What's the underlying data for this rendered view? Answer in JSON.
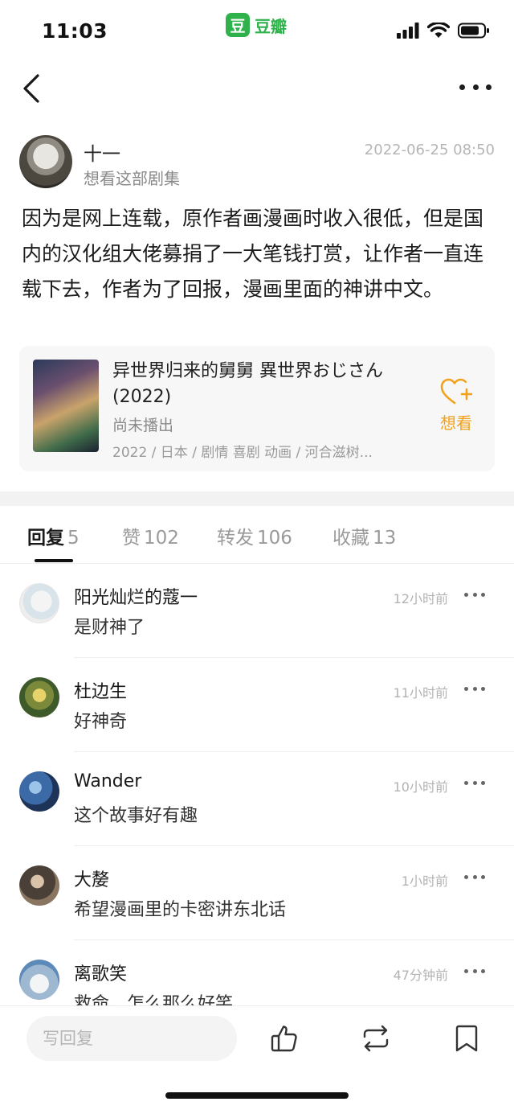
{
  "status_bar": {
    "time": "11:03",
    "app_logo_char": "豆",
    "app_name": "豆瓣"
  },
  "post": {
    "author_name": "十一",
    "author_subtitle": "想看这部剧集",
    "timestamp": "2022-06-25 08:50",
    "content": "因为是网上连载，原作者画漫画时收入很低，但是国内的汉化组大佬募捐了一大笔钱打赏，让作者一直连载下去，作者为了回报，漫画里面的神讲中文。"
  },
  "subject_card": {
    "title": "异世界归来的舅舅 異世界おじさん (2022)",
    "status": "尚未播出",
    "meta": "2022 / 日本 / 剧情 喜剧 动画 / 河合滋树...",
    "wish_label": "想看",
    "wish_icon": "heart-plus-icon"
  },
  "tabs": [
    {
      "label": "回复",
      "count": "5",
      "active": true
    },
    {
      "label": "赞",
      "count": "102"
    },
    {
      "label": "转发",
      "count": "106"
    },
    {
      "label": "收藏",
      "count": "13"
    }
  ],
  "replies": [
    {
      "name": "阳光灿烂的蔻一",
      "text": "是财神了",
      "time": "12小时前"
    },
    {
      "name": "杜边生",
      "text": "好神奇",
      "time": "11小时前"
    },
    {
      "name": "Wander",
      "text": "这个故事好有趣",
      "time": "10小时前"
    },
    {
      "name": "大嫠",
      "text": "希望漫画里的卡密讲东北话",
      "time": "1小时前"
    },
    {
      "name": "离歌笑",
      "text": "救命，怎么那么好笑",
      "time": "47分钟前"
    }
  ],
  "bottom_bar": {
    "reply_placeholder": "写回复",
    "icons": [
      "thumbs-up-icon",
      "repost-icon",
      "bookmark-icon"
    ]
  },
  "colors": {
    "brand": "#2fb24c",
    "accent": "#f0a21e"
  }
}
